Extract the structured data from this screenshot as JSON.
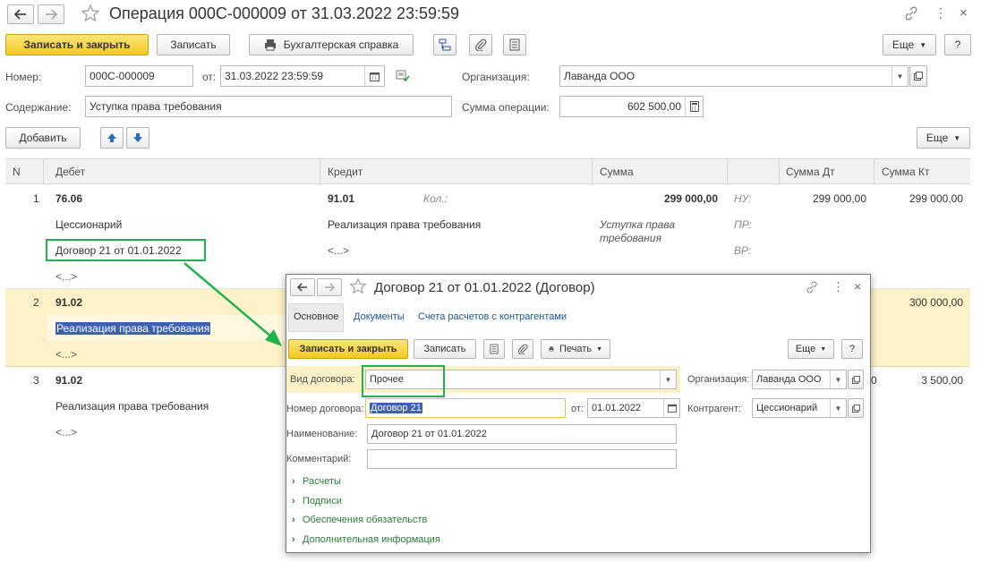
{
  "main": {
    "title": "Операция 000С-000009 от 31.03.2022 23:59:59",
    "toolbar": {
      "save_close": "Записать и закрыть",
      "save": "Записать",
      "report": "Бухгалтерская справка",
      "more": "Еще",
      "help": "?"
    },
    "form": {
      "number_label": "Номер:",
      "number_value": "000С-000009",
      "date_label": "от:",
      "date_value": "31.03.2022 23:59:59",
      "org_label": "Организация:",
      "org_value": "Лаванда ООО",
      "content_label": "Содержание:",
      "content_value": "Уступка права требования",
      "sum_label": "Сумма операции:",
      "sum_value": "602 500,00"
    },
    "table_toolbar": {
      "add": "Добавить",
      "more": "Еще"
    },
    "columns": [
      "N",
      "Дебет",
      "Кредит",
      "Сумма",
      "Сумма Дт",
      "Сумма Кт"
    ],
    "rows": [
      {
        "n": "1",
        "debit": "76.06",
        "debit_sub1": "Цессионарий",
        "debit_sub2": "Договор 21 от 01.01.2022",
        "debit_sub3": "<...>",
        "credit": "91.01",
        "qty_label": "Кол.:",
        "credit_sub1": "Реализация права требования",
        "credit_sub2": "<...>",
        "sum": "299 000,00",
        "sum_note": "Уступка права требования",
        "nu": "НУ:",
        "pr": "ПР:",
        "vr": "ВР:",
        "sum_dt": "299 000,00",
        "sum_kt": "299 000,00"
      },
      {
        "n": "2",
        "debit": "91.02",
        "debit_sub1": "Реализация права требования",
        "debit_sub2": "<...>",
        "sum_kt": "300 000,00"
      },
      {
        "n": "3",
        "debit": "91.02",
        "debit_sub1": "Реализация права требования",
        "debit_sub2": "<...>",
        "sum_dt_tail": "0",
        "sum_kt": "3 500,00"
      }
    ]
  },
  "dialog": {
    "title": "Договор 21 от 01.01.2022 (Договор)",
    "tabs": [
      "Основное",
      "Документы",
      "Счета расчетов с контрагентами"
    ],
    "toolbar": {
      "save_close": "Записать и закрыть",
      "save": "Записать",
      "print": "Печать",
      "more": "Еще",
      "help": "?"
    },
    "form": {
      "kind_label": "Вид договора:",
      "kind_value": "Прочее",
      "org_label": "Организация:",
      "org_value": "Лаванда ООО",
      "number_label": "Номер договора:",
      "number_value": "Договор 21",
      "date_label": "от:",
      "date_value": "01.01.2022",
      "contractor_label": "Контрагент:",
      "contractor_value": "Цессионарий",
      "name_label": "Наименование:",
      "name_value": "Договор 21 от 01.01.2022",
      "comment_label": "Комментарий:",
      "comment_value": ""
    },
    "groups": [
      "Расчеты",
      "Подписи",
      "Обеспечения обязательств",
      "Дополнительная информация"
    ]
  },
  "colors": {
    "accent_yellow": "#f5c922",
    "selected_row": "#fdf1c7",
    "highlight_green": "#22b14c",
    "selection_blue": "#3d5fb6"
  }
}
